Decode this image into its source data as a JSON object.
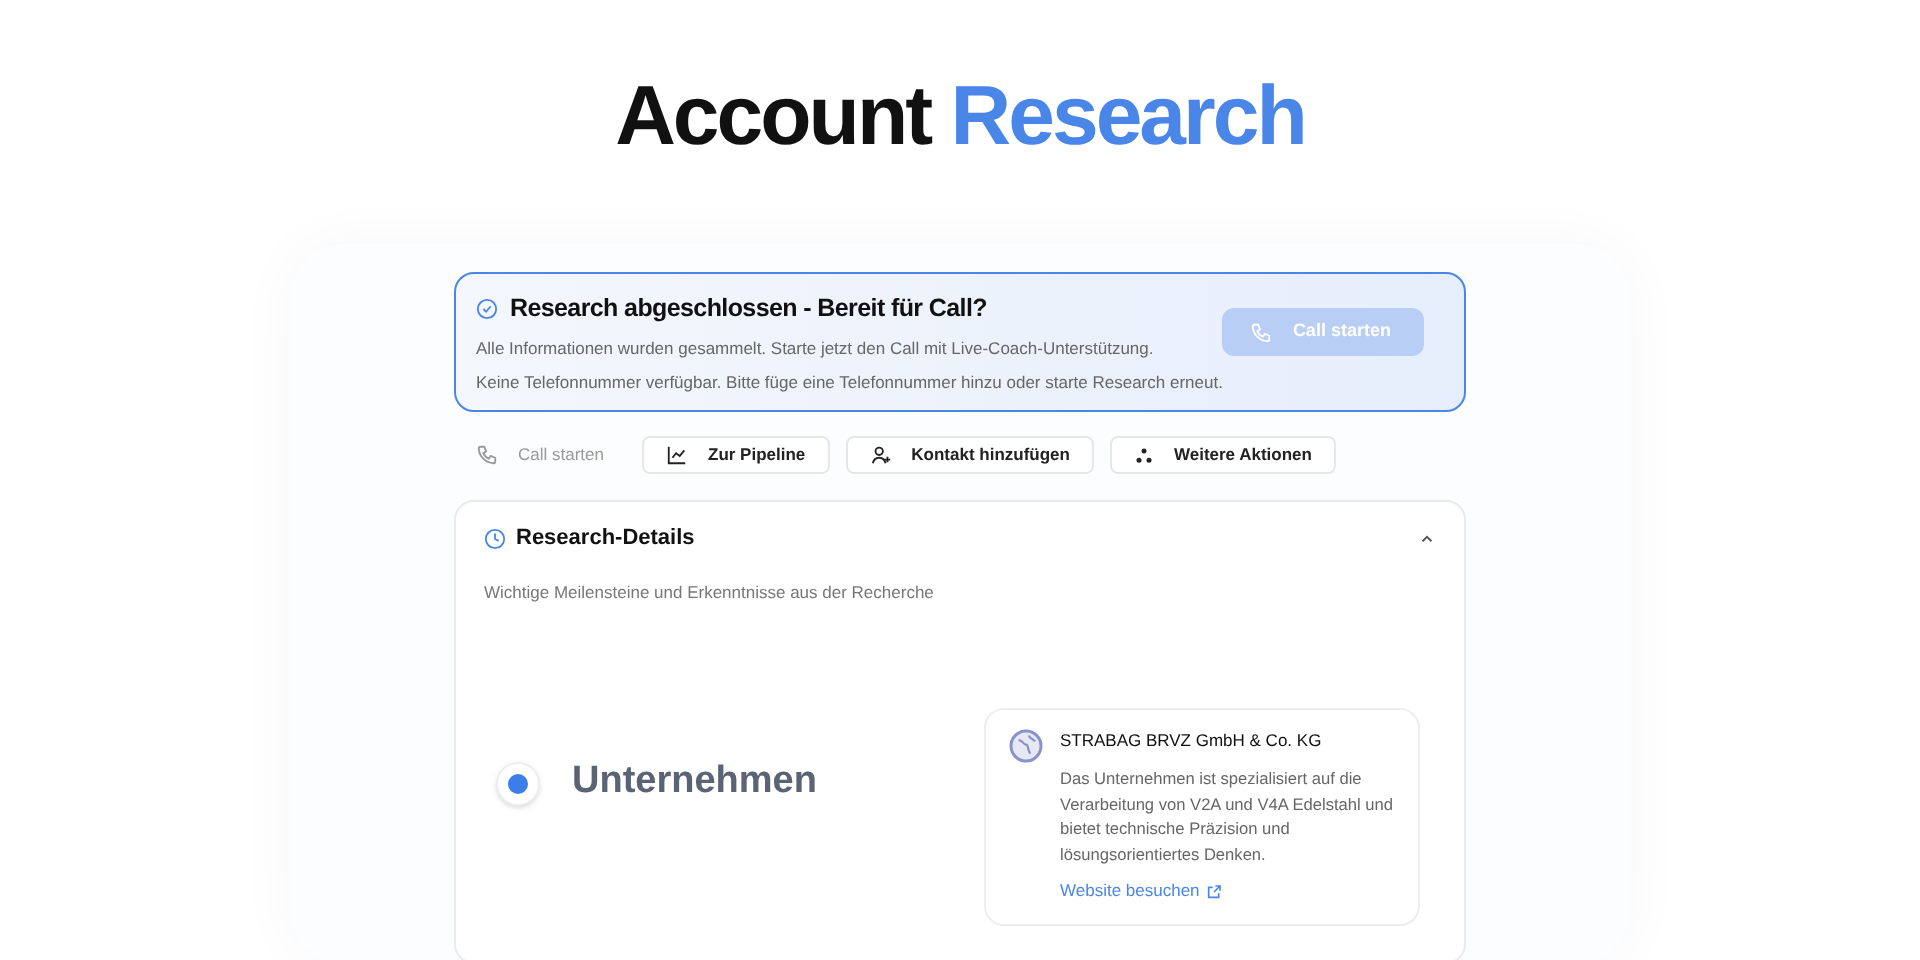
{
  "heading": [
    {
      "text": "Account",
      "accent": false
    },
    {
      "text": "Research",
      "accent": true
    }
  ],
  "banner": {
    "title": "Research abgeschlossen - Bereit für Call?",
    "lines": [
      "Alle Informationen wurden gesammelt. Starte jetzt den Call mit Live-Coach-Unterstützung.",
      "Keine Telefonnummer verfügbar. Bitte füge eine Telefonnummer hinzu oder starte Research erneut."
    ],
    "button": {
      "label": "Call starten",
      "disabled": true
    }
  },
  "actions": [
    {
      "kind": "phone",
      "label": "Call starten",
      "disabled": true
    },
    {
      "kind": "chart",
      "label": "Zur Pipeline",
      "disabled": false
    },
    {
      "kind": "user",
      "label": "Kontakt hinzufügen",
      "disabled": false
    },
    {
      "kind": "dots",
      "label": "Weitere Aktionen",
      "disabled": false
    }
  ],
  "details": {
    "title": "Research-Details",
    "expanded": true,
    "subtitle": "Wichtige Meilensteine und Erkenntnisse aus der Recherche",
    "milestones": [
      {
        "label": "Unternehmen",
        "selected": true,
        "card": {
          "name": "STRABAG BRVZ GmbH & Co. KG",
          "text": "Das Unternehmen ist spezialisiert auf die Verarbeitung von V2A und V4A Edelstahl und bietet technische Präzision und lösungsorientiertes Denken.",
          "link": "Website besuchen"
        }
      }
    ]
  }
}
